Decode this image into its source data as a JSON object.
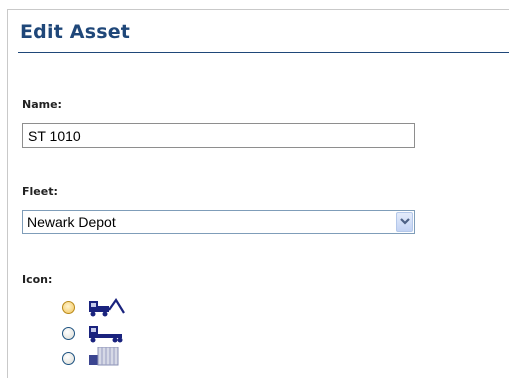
{
  "panel": {
    "title": "Edit Asset"
  },
  "form": {
    "name_label": "Name:",
    "name_value": "ST 1010",
    "fleet_label": "Fleet:",
    "fleet_value": "Newark Depot",
    "icon_label": "Icon:"
  },
  "icon_options": [
    {
      "icon": "tow-truck-icon",
      "state": "hover"
    },
    {
      "icon": "flatbed-truck-icon",
      "state": "normal"
    },
    {
      "icon": "box-truck-icon",
      "state": "normal"
    }
  ],
  "colors": {
    "title": "#1f4779",
    "icon_blue": "#1a237e"
  }
}
